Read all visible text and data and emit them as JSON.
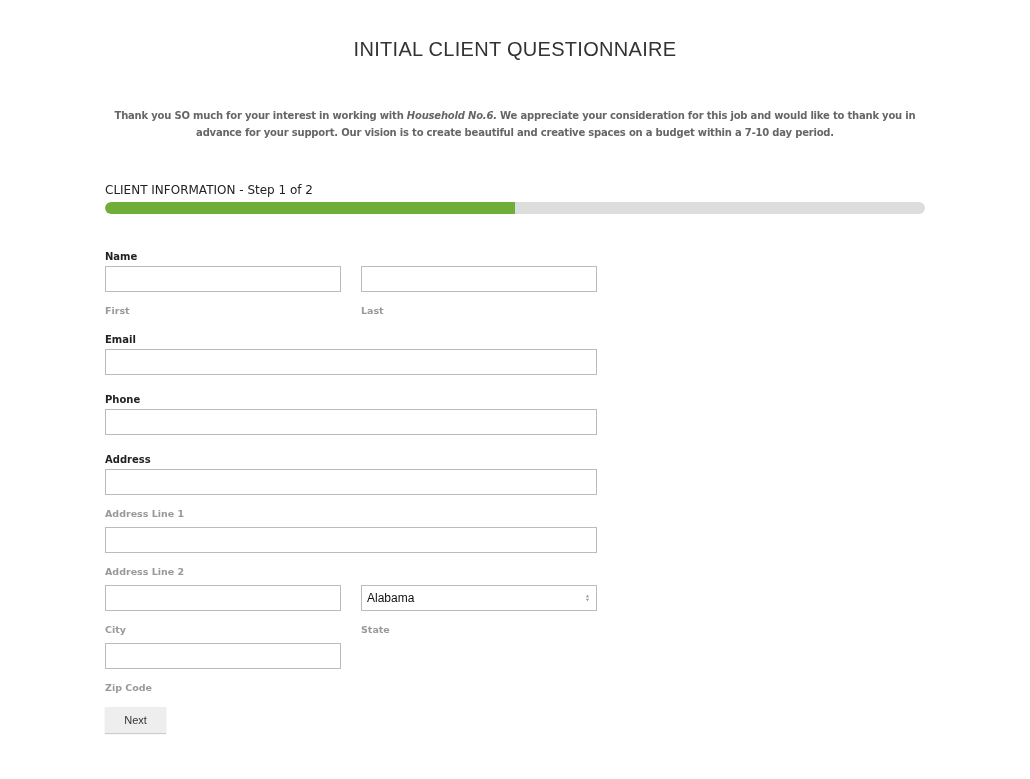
{
  "title": "INITIAL CLIENT QUESTIONNAIRE",
  "intro": "Thank you SO much for your interest in working with *Household No.6.* We appreciate your consideration for this job and would like to thank you in advance for your support. Our vision is to create beautiful and creative spaces on a budget within a 7-10 day period.",
  "progress": {
    "label": "CLIENT INFORMATION - Step 1 of 2",
    "level": 0.5
  },
  "groups": [
    {
      "label": "Name",
      "rows": [
        {
          "fields": [
            {
              "kind": "text",
              "sublabel": "First"
            },
            {
              "kind": "text",
              "sublabel": "Last"
            }
          ]
        }
      ]
    },
    {
      "label": "Email",
      "rows": [
        {
          "fields": [
            {
              "kind": "text",
              "wide": true
            }
          ]
        }
      ]
    },
    {
      "label": "Phone",
      "rows": [
        {
          "fields": [
            {
              "kind": "text",
              "wide": true
            }
          ]
        }
      ]
    },
    {
      "label": "Address",
      "rows": [
        {
          "fields": [
            {
              "kind": "text",
              "wide": true,
              "sublabel": "Address Line 1"
            }
          ]
        },
        {
          "fields": [
            {
              "kind": "text",
              "wide": true,
              "sublabel": "Address Line 2"
            }
          ]
        },
        {
          "fields": [
            {
              "kind": "text",
              "sublabel": "City"
            },
            {
              "kind": "select",
              "value": "Alabama",
              "sublabel": "State"
            }
          ]
        },
        {
          "fields": [
            {
              "kind": "text",
              "sublabel": "Zip Code"
            }
          ]
        }
      ]
    }
  ],
  "button": "Next"
}
